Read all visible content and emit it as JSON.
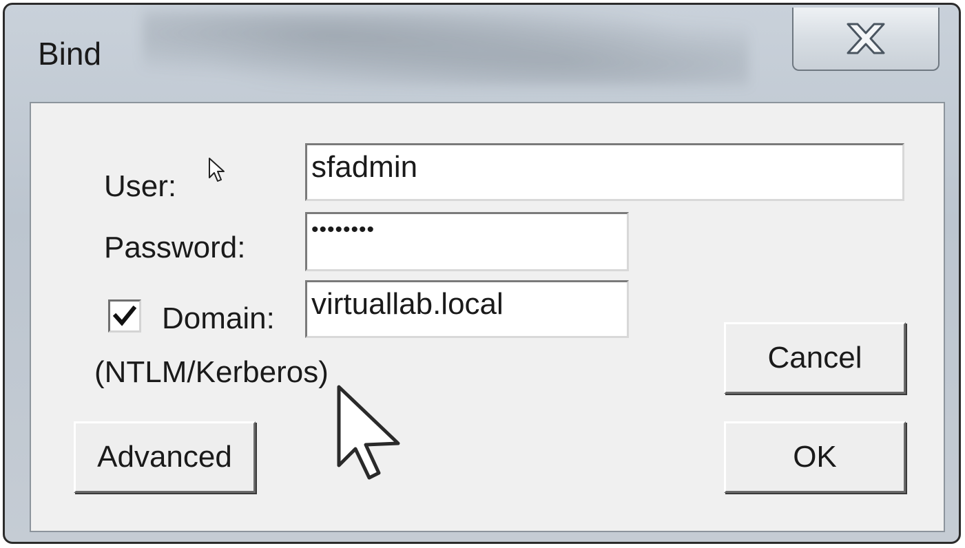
{
  "window": {
    "title": "Bind",
    "close_icon": "close-x-icon"
  },
  "form": {
    "user_label": "User:",
    "user_value": "sfadmin",
    "password_label": "Password:",
    "password_value": "••••••••",
    "domain_checkbox_checked": true,
    "domain_label": "Domain:",
    "domain_value": "virtuallab.local",
    "auth_note": "(NTLM/Kerberos)"
  },
  "buttons": {
    "cancel": "Cancel",
    "ok": "OK",
    "advanced": "Advanced"
  },
  "cursor": {
    "icons": [
      "arrow-cursor-icon",
      "arrow-cursor-icon"
    ]
  }
}
